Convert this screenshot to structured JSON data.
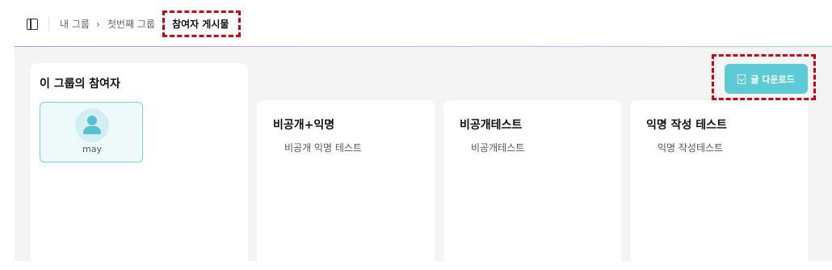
{
  "header": {
    "sidebar_toggle_icon": "sidebar-panel-icon",
    "breadcrumb": [
      {
        "label": "내 그룹"
      },
      {
        "label": "첫번째 그룹"
      },
      {
        "label": "참여자 게시물"
      }
    ],
    "separator": "›"
  },
  "participants": {
    "title": "이 그룹의 참여자",
    "members": [
      {
        "name": "may",
        "icon": "user-avatar-icon"
      }
    ]
  },
  "download": {
    "label": "글 다운로드",
    "icon": "file-download-icon"
  },
  "posts": [
    {
      "title": "비공개+익명",
      "body": "비공개 익명 테스트"
    },
    {
      "title": "비공개테스트",
      "body": "비공개테스트"
    },
    {
      "title": "익명 작성 테스트",
      "body": "익명 작성테스트"
    }
  ],
  "colors": {
    "accent": "#5ccbd5",
    "highlight": "#d0021b",
    "background": "#f4f4f5"
  }
}
